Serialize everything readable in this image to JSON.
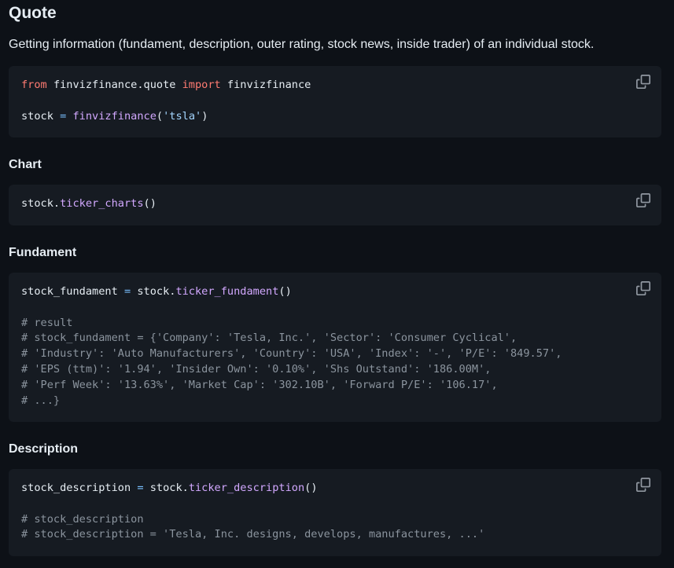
{
  "quote": {
    "title": "Quote",
    "description": "Getting information (fundament, description, outer rating, stock news, inside trader) of an individual stock.",
    "code": {
      "from": "from",
      "module": "finvizfinance.quote",
      "import": "import",
      "class_name": "finvizfinance",
      "var": "stock",
      "eq": "=",
      "call": "finvizfinance",
      "arg": "'tsla'"
    }
  },
  "chart": {
    "title": "Chart",
    "code": {
      "obj": "stock",
      "method": "ticker_charts"
    }
  },
  "fundament": {
    "title": "Fundament",
    "code": {
      "var": "stock_fundament",
      "eq": "=",
      "obj": "stock",
      "method": "ticker_fundament",
      "comments": [
        "# result",
        "# stock_fundament = {'Company': 'Tesla, Inc.', 'Sector': 'Consumer Cyclical',",
        "# 'Industry': 'Auto Manufacturers', 'Country': 'USA', 'Index': '-', 'P/E': '849.57',",
        "# 'EPS (ttm)': '1.94', 'Insider Own': '0.10%', 'Shs Outstand': '186.00M',",
        "# 'Perf Week': '13.63%', 'Market Cap': '302.10B', 'Forward P/E': '106.17',",
        "# ...}"
      ]
    }
  },
  "description": {
    "title": "Description",
    "code": {
      "var": "stock_description",
      "eq": "=",
      "obj": "stock",
      "method": "ticker_description",
      "comments": [
        "# stock_description",
        "# stock_description = 'Tesla, Inc. designs, develops, manufactures, ...'"
      ]
    }
  }
}
